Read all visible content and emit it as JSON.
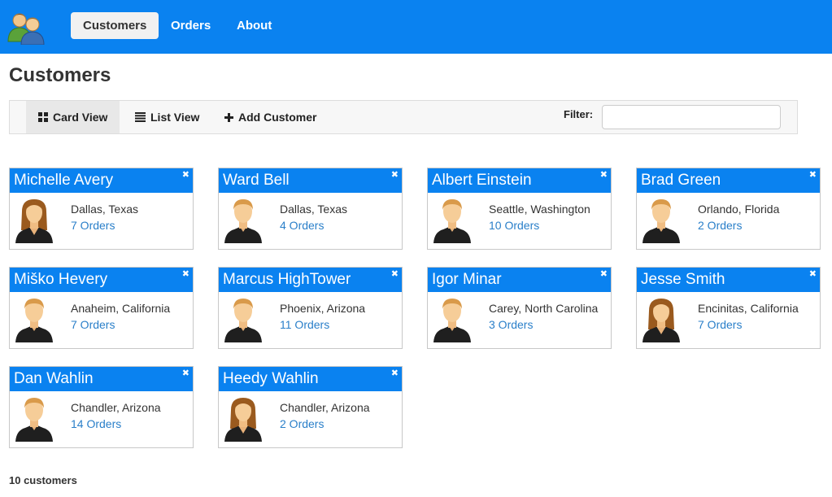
{
  "nav": {
    "logo_icon": "people-icon",
    "items": [
      {
        "label": "Customers",
        "active": true
      },
      {
        "label": "Orders",
        "active": false
      },
      {
        "label": "About",
        "active": false
      }
    ]
  },
  "page": {
    "title": "Customers"
  },
  "toolbar": {
    "card_view_label": "Card View",
    "list_view_label": "List View",
    "add_customer_label": "Add Customer",
    "filter_label": "Filter:",
    "filter_value": ""
  },
  "customers": [
    {
      "name": "Michelle Avery",
      "location": "Dallas, Texas",
      "orders": "7 Orders",
      "gender": "female"
    },
    {
      "name": "Ward Bell",
      "location": "Dallas, Texas",
      "orders": "4 Orders",
      "gender": "male"
    },
    {
      "name": "Albert Einstein",
      "location": "Seattle, Washington",
      "orders": "10 Orders",
      "gender": "male"
    },
    {
      "name": "Brad Green",
      "location": "Orlando, Florida",
      "orders": "2 Orders",
      "gender": "male"
    },
    {
      "name": "Miško Hevery",
      "location": "Anaheim, California",
      "orders": "7 Orders",
      "gender": "male"
    },
    {
      "name": "Marcus HighTower",
      "location": "Phoenix, Arizona",
      "orders": "11 Orders",
      "gender": "male"
    },
    {
      "name": "Igor Minar",
      "location": "Carey, North Carolina",
      "orders": "3 Orders",
      "gender": "male"
    },
    {
      "name": "Jesse Smith",
      "location": "Encinitas, California",
      "orders": "7 Orders",
      "gender": "female"
    },
    {
      "name": "Dan Wahlin",
      "location": "Chandler, Arizona",
      "orders": "14 Orders",
      "gender": "male"
    },
    {
      "name": "Heedy Wahlin",
      "location": "Chandler, Arizona",
      "orders": "2 Orders",
      "gender": "female"
    }
  ],
  "footer": {
    "count_label": "10 customers"
  },
  "colors": {
    "brand": "#0a82f0",
    "link": "#2a7fc9"
  }
}
